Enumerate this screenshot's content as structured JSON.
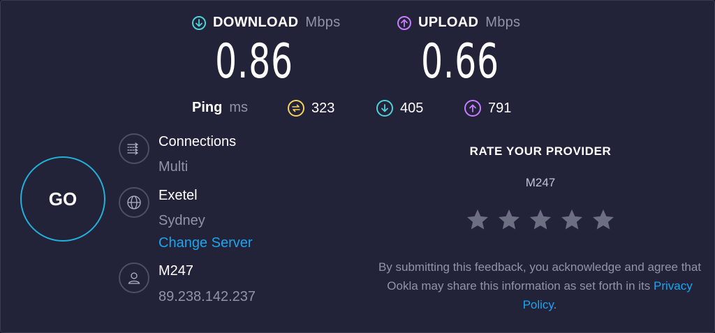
{
  "download": {
    "label": "DOWNLOAD",
    "unit": "Mbps",
    "value": "0.86",
    "color": "#4fd1d9"
  },
  "upload": {
    "label": "UPLOAD",
    "unit": "Mbps",
    "value": "0.66",
    "color": "#c77dff"
  },
  "ping": {
    "label": "Ping",
    "unit": "ms",
    "idle": "323",
    "download": "405",
    "upload": "791",
    "idle_color": "#f4d35e"
  },
  "go_label": "GO",
  "connections": {
    "title": "Connections",
    "value": "Multi"
  },
  "server": {
    "name": "Exetel",
    "location": "Sydney",
    "change_label": "Change Server"
  },
  "provider": {
    "name": "M247",
    "ip": "89.238.142.237"
  },
  "rating": {
    "title": "RATE YOUR PROVIDER",
    "isp": "M247",
    "stars": 5,
    "disclaimer_text": "By submitting this feedback, you acknowledge and agree that Ookla may share this information as set forth in its ",
    "privacy_link": "Privacy Policy",
    "period": "."
  },
  "colors": {
    "background": "#222339",
    "accent": "#1ca4f0",
    "go_ring": "#23b0d8"
  }
}
